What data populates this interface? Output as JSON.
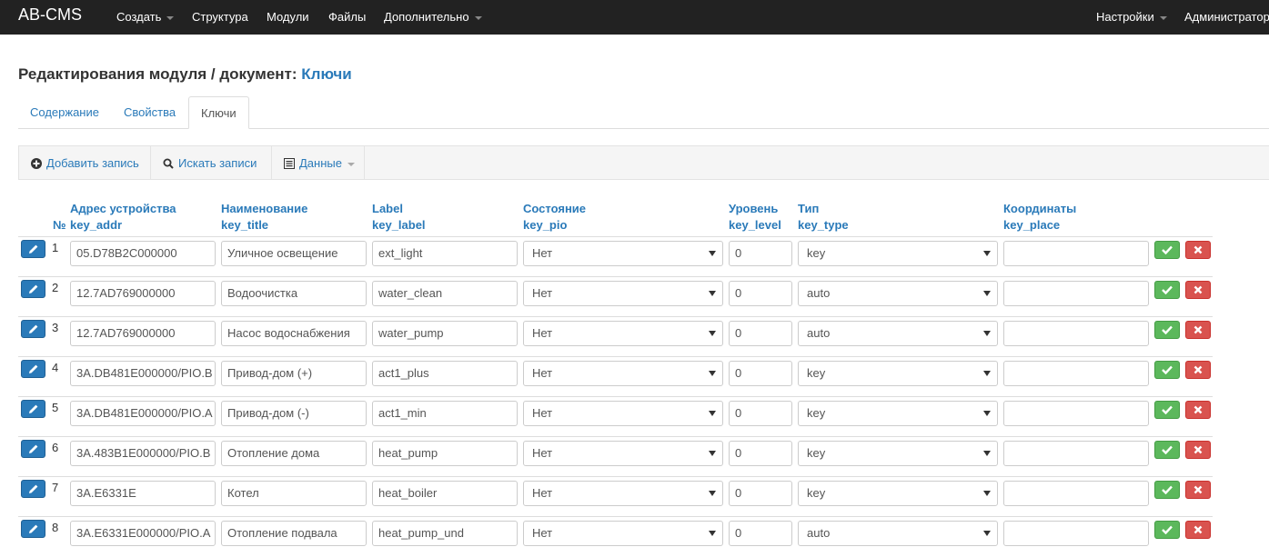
{
  "navbar": {
    "brand": "AB-CMS",
    "left_items": [
      {
        "label": "Создать",
        "dropdown": true
      },
      {
        "label": "Структура",
        "dropdown": false
      },
      {
        "label": "Модули",
        "dropdown": false
      },
      {
        "label": "Файлы",
        "dropdown": false
      },
      {
        "label": "Дополнительно",
        "dropdown": true
      }
    ],
    "right_items": [
      {
        "label": "Настройки",
        "dropdown": true
      },
      {
        "label": "Администратор",
        "dropdown": false
      }
    ]
  },
  "page": {
    "title_prefix": "Редактирования модуля / документ:",
    "document_name": "Ключи"
  },
  "tabs": [
    {
      "label": "Содержание",
      "active": false
    },
    {
      "label": "Свойства",
      "active": false
    },
    {
      "label": "Ключи",
      "active": true
    }
  ],
  "toolbar": {
    "add_label": "Добавить запись",
    "search_label": "Искать записи",
    "data_label": "Данные"
  },
  "table": {
    "number_header": "№",
    "columns": [
      {
        "title": "Адрес устройства",
        "field": "key_addr"
      },
      {
        "title": "Наименование",
        "field": "key_title"
      },
      {
        "title": "Label",
        "field": "key_label"
      },
      {
        "title": "Состояние",
        "field": "key_pio"
      },
      {
        "title": "Уровень",
        "field": "key_level"
      },
      {
        "title": "Тип",
        "field": "key_type"
      },
      {
        "title": "Координаты",
        "field": "key_place"
      }
    ],
    "rows": [
      {
        "num": "1",
        "addr": "05.D78B2C000000",
        "title": "Уличное освещение",
        "label": "ext_light",
        "pio": "Нет",
        "level": "0",
        "type": "key",
        "place": ""
      },
      {
        "num": "2",
        "addr": "12.7AD769000000",
        "title": "Водоочистка",
        "label": "water_clean",
        "pio": "Нет",
        "level": "0",
        "type": "auto",
        "place": ""
      },
      {
        "num": "3",
        "addr": "12.7AD769000000",
        "title": "Насос водоснабжения",
        "label": "water_pump",
        "pio": "Нет",
        "level": "0",
        "type": "auto",
        "place": ""
      },
      {
        "num": "4",
        "addr": "3A.DB481E000000/PIO.B",
        "title": "Привод-дом (+)",
        "label": "act1_plus",
        "pio": "Нет",
        "level": "0",
        "type": "key",
        "place": ""
      },
      {
        "num": "5",
        "addr": "3A.DB481E000000/PIO.A",
        "title": "Привод-дом (-)",
        "label": "act1_min",
        "pio": "Нет",
        "level": "0",
        "type": "key",
        "place": ""
      },
      {
        "num": "6",
        "addr": "3A.483B1E000000/PIO.B",
        "title": "Отопление дома",
        "label": "heat_pump",
        "pio": "Нет",
        "level": "0",
        "type": "key",
        "place": ""
      },
      {
        "num": "7",
        "addr": "3A.E6331E",
        "title": "Котел",
        "label": "heat_boiler",
        "pio": "Нет",
        "level": "0",
        "type": "key",
        "place": ""
      },
      {
        "num": "8",
        "addr": "3A.E6331E000000/PIO.A",
        "title": "Отопление подвала",
        "label": "heat_pump_und",
        "pio": "Нет",
        "level": "0",
        "type": "auto",
        "place": ""
      }
    ]
  },
  "colors": {
    "navbar_bg": "#222222",
    "link": "#2a7ab9",
    "edit_button": "#2a7ab9",
    "save_button": "#5cb85c",
    "delete_button": "#d9534f"
  }
}
